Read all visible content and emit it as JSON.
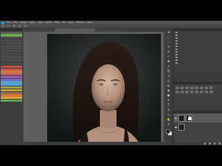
{
  "app": {
    "accent": "#1e8fd6",
    "background": "#454545"
  },
  "menu": {
    "items": [
      "File",
      "Edit",
      "Image",
      "Layer",
      "Type",
      "Select",
      "Filter",
      "3D",
      "View",
      "Window",
      "Help"
    ]
  },
  "doc_tabs": [
    "",
    "",
    ""
  ],
  "status": {
    "zoom": ""
  },
  "left_panel": {
    "items": [
      {
        "label": "",
        "color": "#5c5c5c"
      },
      {
        "label": "",
        "color": "#6aa84f"
      },
      {
        "label": "",
        "color": "#4a4a4a"
      },
      {
        "label": "",
        "color": "#4a4a4a"
      },
      {
        "label": "",
        "color": "#4a4a4a"
      },
      {
        "label": "",
        "color": "#4a4a4a"
      },
      {
        "label": "",
        "color": "#4a4a4a"
      },
      {
        "label": "",
        "color": "#4a4a4a"
      },
      {
        "label": "",
        "color": "#4a4a4a"
      },
      {
        "label": "",
        "color": "#4a4a4a"
      },
      {
        "label": "",
        "color": "#4a4a4a"
      },
      {
        "label": "",
        "color": "#4a4a4a"
      },
      {
        "label": "",
        "color": "#4a4a4a"
      },
      {
        "label": "",
        "color": "#c9504f"
      },
      {
        "label": "",
        "color": "#c9504f"
      },
      {
        "label": "",
        "color": "#d07a3a"
      },
      {
        "label": "",
        "color": "#c25a6e"
      },
      {
        "label": "",
        "color": "#a55bb0"
      },
      {
        "label": "",
        "color": "#6a6ad0"
      },
      {
        "label": "",
        "color": "#5aa0c8"
      },
      {
        "label": "",
        "color": "#4f9fd6"
      },
      {
        "label": "",
        "color": "#9aa852"
      },
      {
        "label": "",
        "color": "#c9a33a"
      },
      {
        "label": "",
        "color": "#8a6f4a"
      },
      {
        "label": "",
        "color": "#d07a3a"
      },
      {
        "label": "",
        "color": "#e0a43a"
      },
      {
        "label": "",
        "color": "#6aa84f"
      }
    ]
  },
  "toolbar": {
    "tools": [
      "move-tool",
      "marquee-tool",
      "lasso-tool",
      "quick-select-tool",
      "crop-tool",
      "eyedropper-tool",
      "healing-tool",
      "brush-tool",
      "clone-stamp-tool",
      "history-brush-tool",
      "eraser-tool",
      "gradient-tool",
      "blur-tool",
      "dodge-tool",
      "pen-tool",
      "type-tool",
      "path-select-tool",
      "shape-tool",
      "hand-tool",
      "zoom-tool"
    ],
    "foreground_color": "#111111",
    "background_color": "#ffffff"
  },
  "history_panel": {
    "title": "",
    "items": [
      "",
      "",
      "",
      "",
      "",
      "",
      "",
      "",
      "",
      "",
      "",
      ""
    ]
  },
  "adjustments_panel": {
    "title": "",
    "icon_count": 16
  },
  "layers_panel": {
    "title": "",
    "layers": [
      {
        "name": "",
        "has_mask": true,
        "selected": true
      },
      {
        "name": "",
        "has_mask": false,
        "selected": false
      }
    ]
  }
}
